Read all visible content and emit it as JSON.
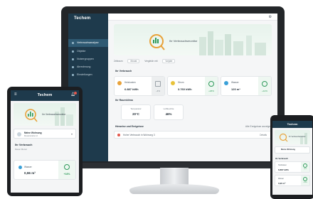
{
  "brand": {
    "logo_text": "Techem",
    "accent": "#1e3a4c",
    "positive": "#2e9a5a",
    "alert": "#e2574c"
  },
  "desktop": {
    "sidebar": {
      "items": [
        {
          "label": "Verbrauchsanalyse",
          "icon": "chart-icon",
          "active": true
        },
        {
          "label": "Objekte",
          "icon": "building-icon",
          "active": false
        },
        {
          "label": "Nutzergruppen",
          "icon": "users-icon",
          "active": false
        },
        {
          "label": "Abrechnung",
          "icon": "document-icon",
          "active": false
        },
        {
          "label": "Einstellungen",
          "icon": "gear-icon",
          "active": false
        }
      ]
    },
    "hero": {
      "title": "Ihr Verbrauchsmonitor"
    },
    "filter": {
      "label": "Zeitraum",
      "period": "Monat",
      "compare_label": "Vergleich mit",
      "compare_value": "Vorjahr"
    },
    "consumption": {
      "heading": "Ihr Verbrauch",
      "cards": [
        {
          "label": "Heizkosten",
          "value": "6.887 kWh",
          "side": "–4%",
          "icon_color": "#e8a23a",
          "side_state": "grey"
        },
        {
          "label": "Strom",
          "value": "3.760 kWh",
          "side": "+18%",
          "icon_color": "#e8c23a",
          "side_state": "green"
        },
        {
          "label": "Wasser",
          "value": "120 m³",
          "side": "+12%",
          "icon_color": "#3aa0d8",
          "side_state": "green"
        }
      ]
    },
    "climate": {
      "heading": "Ihr Raumklima",
      "cards": [
        {
          "label": "Temperatur",
          "value": "20°C"
        },
        {
          "label": "Luftfeuchte",
          "value": "46%"
        }
      ]
    },
    "alerts": {
      "heading": "Hinweise und Ereignisse",
      "link": "Alle Ereignisse anzeigen",
      "rows": [
        {
          "text": "Hoher Verbrauch in Wohnung 3",
          "right": "Details"
        }
      ]
    }
  },
  "tablet": {
    "header": {
      "logo_text": "Techem"
    },
    "hero": {
      "title": "Ihr Verbrauchsmonitor"
    },
    "select": {
      "label": "Meine Wohnung",
      "sub": "Musterstraße 12"
    },
    "section": {
      "title": "Ihr Verbrauch",
      "sub": "Dieser Monat"
    },
    "card": {
      "label": "Wasser",
      "value": "0,96 m³",
      "side": "+16%"
    }
  },
  "phone": {
    "header": {
      "logo_text": "Techem"
    },
    "hero": {
      "title": "Ihr Verbrauchsmonitor"
    },
    "select": {
      "label": "Meine Wohnung"
    },
    "section": {
      "title": "Ihr Verbrauch"
    },
    "cards": [
      {
        "label": "Heizkosten",
        "value": "6.887 kWh",
        "side": "+4%"
      },
      {
        "label": "Wasser",
        "value": "0,96 m³",
        "side": "+16%"
      }
    ]
  }
}
